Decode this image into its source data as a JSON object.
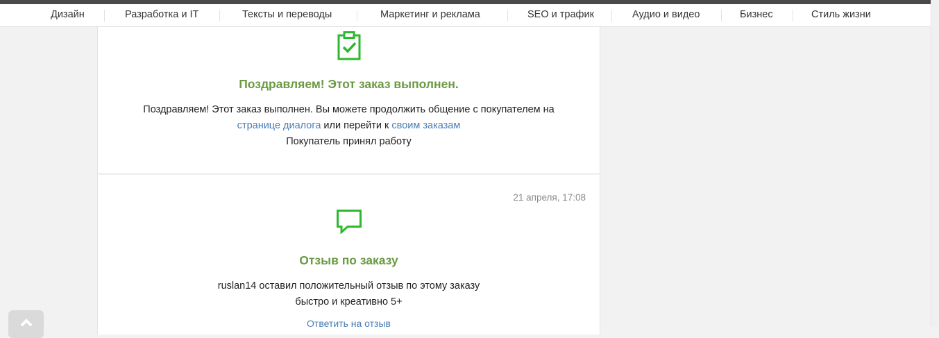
{
  "nav": {
    "items": [
      {
        "label": "Дизайн"
      },
      {
        "label": "Разработка и IT"
      },
      {
        "label": "Тексты и переводы"
      },
      {
        "label": "Маркетинг и реклама"
      },
      {
        "label": "SEO и трафик"
      },
      {
        "label": "Аудио и видео"
      },
      {
        "label": "Бизнес"
      },
      {
        "label": "Стиль жизни"
      }
    ]
  },
  "completed": {
    "icon": "clipboard-check-icon",
    "title": "Поздравляем! Этот заказ выполнен.",
    "line1": "Поздравляем! Этот заказ выполнен. Вы можете продолжить общение с покупателем на",
    "link_dialog": "странице диалога",
    "middle": " или перейти к ",
    "link_orders": "своим заказам",
    "line3": "Покупатель принял работу"
  },
  "review": {
    "date": "21 апреля, 17:08",
    "icon": "speech-bubble-icon",
    "title": "Отзыв по заказу",
    "line1": "ruslan14 оставил положительный отзыв по этому заказу",
    "line2": "быстро и креативно 5+",
    "reply_link": "Ответить на отзыв"
  },
  "colors": {
    "accent_green": "#6a9a42",
    "icon_green": "#2eb82e",
    "link_blue": "#4a7db5"
  }
}
